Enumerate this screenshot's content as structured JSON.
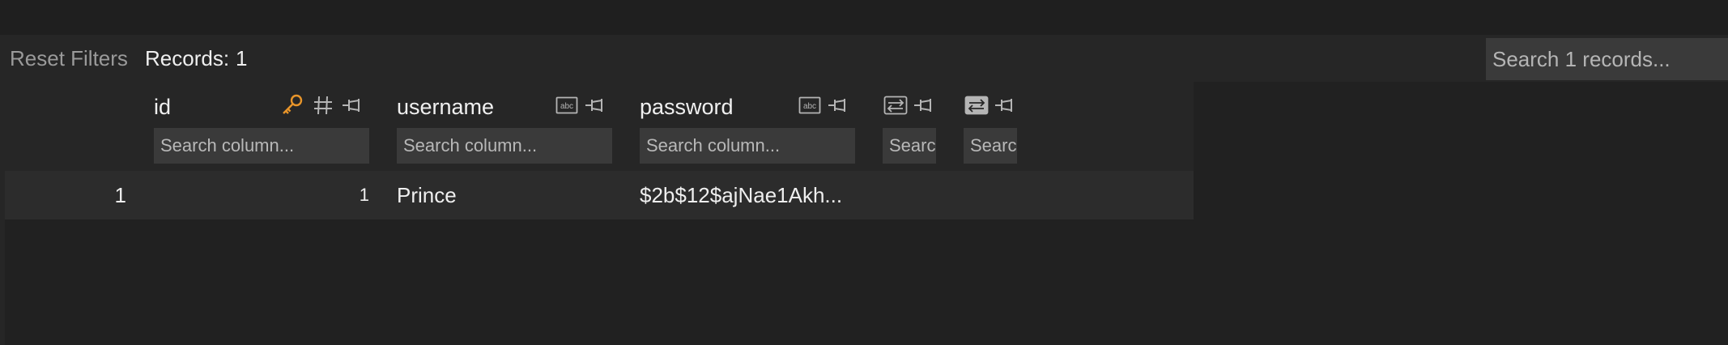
{
  "toolbar": {
    "reset_label": "Reset Filters",
    "records_label": "Records:",
    "records_count": "1",
    "search_placeholder": "Search 1 records..."
  },
  "columns": [
    {
      "title": "id",
      "icons": [
        "key-icon",
        "number-type-icon",
        "pin-icon"
      ],
      "search_placeholder": "Search column..."
    },
    {
      "title": "username",
      "icons": [
        "text-type-icon",
        "pin-icon"
      ],
      "search_placeholder": "Search column..."
    },
    {
      "title": "password",
      "icons": [
        "text-type-icon",
        "pin-icon"
      ],
      "search_placeholder": "Search column..."
    },
    {
      "title": "",
      "icons": [
        "binary-type-icon",
        "pin-icon"
      ],
      "search_placeholder": "Search column..."
    },
    {
      "title": "",
      "icons": [
        "binary-type-icon",
        "pin-icon"
      ],
      "search_placeholder": "Search column..."
    }
  ],
  "rows": [
    {
      "row_number": "1",
      "id": "1",
      "username": "Prince",
      "password": "$2b$12$ajNae1Akh...",
      "col4": "",
      "col5": ""
    }
  ],
  "colors": {
    "background": "#212121",
    "panel": "#262626",
    "row": "#2c2c2c",
    "input": "#3a3a3a",
    "key_accent": "#e8952a",
    "icon_gray": "#b5b5b5"
  }
}
